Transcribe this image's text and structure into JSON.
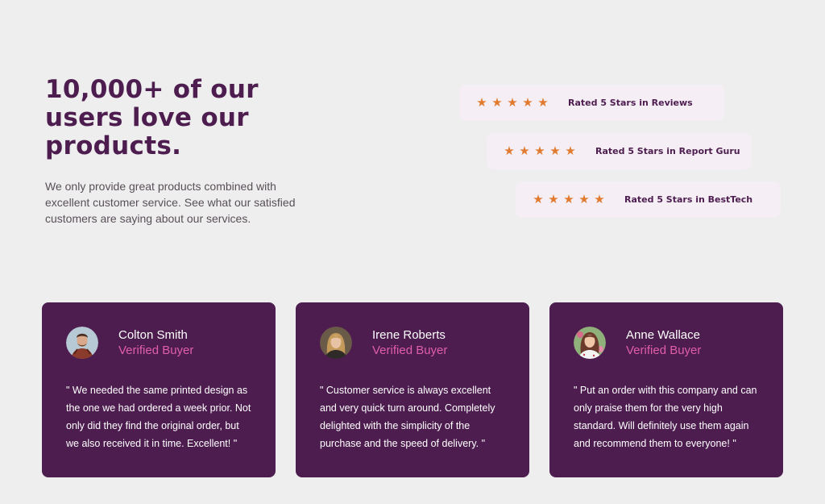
{
  "hero": {
    "title": "10,000+ of our users love our products.",
    "description": "We only provide great products combined with excellent customer service. See what our satisfied customers are saying about our services."
  },
  "ratings": [
    {
      "stars": 5,
      "label": "Rated 5 Stars in Reviews"
    },
    {
      "stars": 5,
      "label": "Rated 5 Stars in Report Guru"
    },
    {
      "stars": 5,
      "label": "Rated 5 Stars in BestTech"
    }
  ],
  "testimonials": [
    {
      "name": "Colton Smith",
      "role": "Verified Buyer",
      "quote": "\" We needed the same printed design as the one we had ordered a week prior. Not only did they find the original order, but we also received it in time. Excellent! \""
    },
    {
      "name": "Irene Roberts",
      "role": "Verified Buyer",
      "quote": "\" Customer service is always excellent and very quick turn around. Completely delighted with the simplicity of the purchase and the speed of delivery. \""
    },
    {
      "name": "Anne Wallace",
      "role": "Verified Buyer",
      "quote": "\" Put an order with this company and can only praise them for the very high standard. Will definitely use them again and recommend them to everyone! \""
    }
  ],
  "colors": {
    "accent": "#4d1d4f",
    "star": "#e07b2f",
    "role": "#e05ea8"
  },
  "icons": {
    "star": "star-icon"
  }
}
